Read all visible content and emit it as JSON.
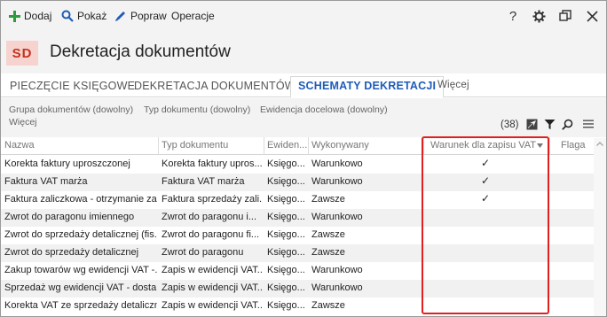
{
  "toolbar": {
    "add_label": "Dodaj",
    "show_label": "Pokaż",
    "edit_label": "Popraw",
    "ops_label": "Operacje",
    "help_label": "?"
  },
  "header": {
    "badge": "SD",
    "title": "Dekretacja dokumentów",
    "badge_color": "#c4321e"
  },
  "tabs": [
    {
      "label": "PIECZĘCIE KSIĘGOWE"
    },
    {
      "label": "DEKRETACJA DOKUMENTÓW"
    },
    {
      "label": "SCHEMATY DEKRETACJI"
    },
    {
      "label": "Więcej"
    }
  ],
  "filters": {
    "group": "Grupa dokumentów (dowolny)",
    "type": "Typ dokumentu (dowolny)",
    "evidence": "Ewidencja docelowa (dowolny)",
    "more": "Więcej",
    "count": "(38)"
  },
  "table": {
    "columns": [
      "Nazwa",
      "Typ dokumentu",
      "Ewiden...",
      "Wykonywany",
      "Warunek dla zapisu VAT",
      "Flaga"
    ],
    "rows": [
      {
        "name": "Korekta faktury uproszczonej",
        "type": "Korekta faktury upros...",
        "ev": "Księgo...",
        "exec": "Warunkowo",
        "vat": "✓"
      },
      {
        "name": "Faktura VAT marża",
        "type": "Faktura VAT marża",
        "ev": "Księgo...",
        "exec": "Warunkowo",
        "vat": "✓"
      },
      {
        "name": "Faktura zaliczkowa - otrzymanie zal...",
        "type": "Faktura sprzedaży zali...",
        "ev": "Księgo...",
        "exec": "Zawsze",
        "vat": "✓"
      },
      {
        "name": "Zwrot do paragonu imiennego",
        "type": "Zwrot do paragonu i...",
        "ev": "Księgo...",
        "exec": "Warunkowo",
        "vat": ""
      },
      {
        "name": "Zwrot do sprzedaży detalicznej (fis...",
        "type": "Zwrot do paragonu fi...",
        "ev": "Księgo...",
        "exec": "Zawsze",
        "vat": ""
      },
      {
        "name": "Zwrot do sprzedaży detalicznej",
        "type": "Zwrot do paragonu",
        "ev": "Księgo...",
        "exec": "Zawsze",
        "vat": ""
      },
      {
        "name": "Zakup towarów wg ewidencji VAT -...",
        "type": "Zapis w ewidencji VAT...",
        "ev": "Księgo...",
        "exec": "Warunkowo",
        "vat": ""
      },
      {
        "name": "Sprzedaż wg ewidencji VAT - dosta...",
        "type": "Zapis w ewidencji VAT...",
        "ev": "Księgo...",
        "exec": "Warunkowo",
        "vat": ""
      },
      {
        "name": "Korekta VAT ze sprzedaży detaliczn...",
        "type": "Zapis w ewidencji VAT...",
        "ev": "Księgo...",
        "exec": "Zawsze",
        "vat": ""
      }
    ]
  },
  "colors": {
    "accent": "#1e5cb8",
    "add_green": "#2e9b3e",
    "highlight": "#e02020"
  }
}
